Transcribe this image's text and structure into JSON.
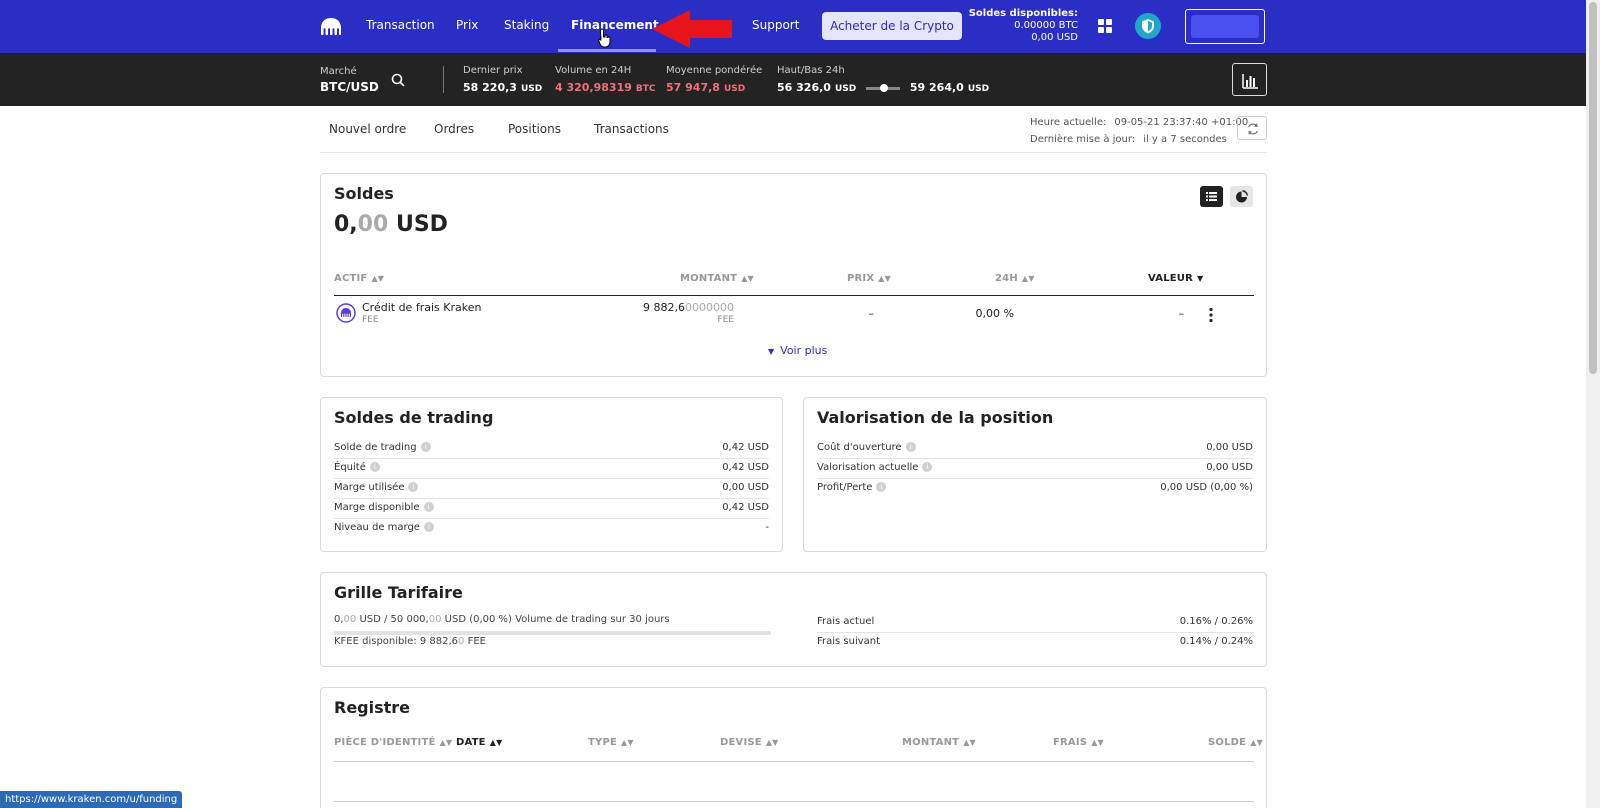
{
  "nav": {
    "links": [
      "Transaction",
      "Prix",
      "Staking",
      "Financement",
      "Support"
    ],
    "buy_button": "Acheter de la Crypto",
    "balances_title": "Soldes disponibles:",
    "balance_btc": "0.00000 BTC",
    "balance_usd": "0,00 USD",
    "brand_color": "#2a2ec4"
  },
  "market": {
    "market_label": "Marché",
    "pair": "BTC/USD",
    "last_price_label": "Dernier prix",
    "last_price": "58 220,3",
    "last_price_unit": "USD",
    "volume_label": "Volume en 24H",
    "volume": "4 320,98319",
    "volume_unit": "BTC",
    "vwap_label": "Moyenne pondérée",
    "vwap": "57 947,8",
    "vwap_unit": "USD",
    "highlow_label": "Haut/Bas 24h",
    "low": "56 326,0",
    "low_unit": "USD",
    "high": "59 264,0",
    "high_unit": "USD"
  },
  "subtabs": [
    "Nouvel ordre",
    "Ordres",
    "Positions",
    "Transactions"
  ],
  "time": {
    "current_label": "Heure actuelle:",
    "current_value": "09-05-21 23:37:40 +01:00",
    "updated_label": "Dernière mise à jour:",
    "updated_value": "il y a 7 secondes"
  },
  "balances": {
    "title": "Soldes",
    "total_int": "0,",
    "total_dec": "00",
    "total_unit": "USD",
    "headers": [
      "ACTIF",
      "MONTANT",
      "PRIX",
      "24H",
      "VALEUR"
    ],
    "row": {
      "name": "Crédit de frais Kraken",
      "code": "FEE",
      "amount_main": "9 882,6",
      "amount_dim": "0000000",
      "amount_unit": "FEE",
      "price": "–",
      "change": "0,00 %",
      "value": "–"
    },
    "see_more": "Voir plus"
  },
  "trading": {
    "title": "Soldes de trading",
    "rows": [
      {
        "label": "Solde de trading",
        "value": "0,42 USD"
      },
      {
        "label": "Équité",
        "value": "0,42 USD"
      },
      {
        "label": "Marge utilisée",
        "value": "0,00 USD"
      },
      {
        "label": "Marge disponible",
        "value": "0,42 USD"
      },
      {
        "label": "Niveau de marge",
        "value": "-"
      }
    ]
  },
  "position": {
    "title": "Valorisation de la position",
    "rows": [
      {
        "label": "Coût d'ouverture",
        "value": "0,00 USD"
      },
      {
        "label": "Valorisation actuelle",
        "value": "0,00 USD"
      },
      {
        "label": "Profit/Perte",
        "value": "0,00 USD (0,00 %)"
      }
    ]
  },
  "fees": {
    "title": "Grille Tarifaire",
    "volume_line_a": "0,",
    "volume_line_a_dim": "00",
    "volume_line_b": " USD  /  50 000,",
    "volume_line_b_dim": "00",
    "volume_line_c": " USD  (0,00 %)   Volume de trading sur 30 jours",
    "kfee_a": "KFEE disponible: 9 882,6",
    "kfee_dim": "0",
    "kfee_b": " FEE",
    "current_label": "Frais actuel",
    "current_value": "0.16% / 0.26%",
    "next_label": "Frais suivant",
    "next_value": "0.14% / 0.24%"
  },
  "ledger": {
    "title": "Registre",
    "headers": [
      "PIÈCE D'IDENTITÉ",
      "DATE",
      "TYPE",
      "DEVISE",
      "MONTANT",
      "FRAIS",
      "SOLDE"
    ]
  },
  "status_url": "https://www.kraken.com/u/funding"
}
